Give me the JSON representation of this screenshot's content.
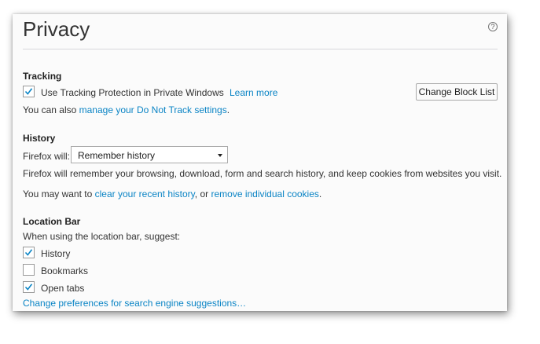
{
  "page": {
    "title": "Privacy",
    "help_icon": "question-circle-icon"
  },
  "tracking": {
    "heading": "Tracking",
    "checkbox_label": "Use Tracking Protection in Private Windows",
    "checked": true,
    "learn_more": "Learn more",
    "change_block_list": "Change Block List",
    "dnt_prefix": "You can also",
    "dnt_link": "manage your Do Not Track settings",
    "dnt_suffix": "."
  },
  "history": {
    "heading": "History",
    "firefox_will_label": "Firefox will:",
    "select_value": "Remember history",
    "description": "Firefox will remember your browsing, download, form and search history, and keep cookies from websites you visit.",
    "may_want_prefix": "You may want to",
    "clear_link": "clear your recent history",
    "middle": ", or",
    "remove_link": "remove individual cookies",
    "suffix": "."
  },
  "location_bar": {
    "heading": "Location Bar",
    "suggest_label": "When using the location bar, suggest:",
    "options": [
      {
        "label": "History",
        "checked": true
      },
      {
        "label": "Bookmarks",
        "checked": false
      },
      {
        "label": "Open tabs",
        "checked": true
      }
    ],
    "search_prefs_link": "Change preferences for search engine suggestions…"
  },
  "colors": {
    "link": "#0a84c5",
    "checkmark": "#0a84c5"
  }
}
